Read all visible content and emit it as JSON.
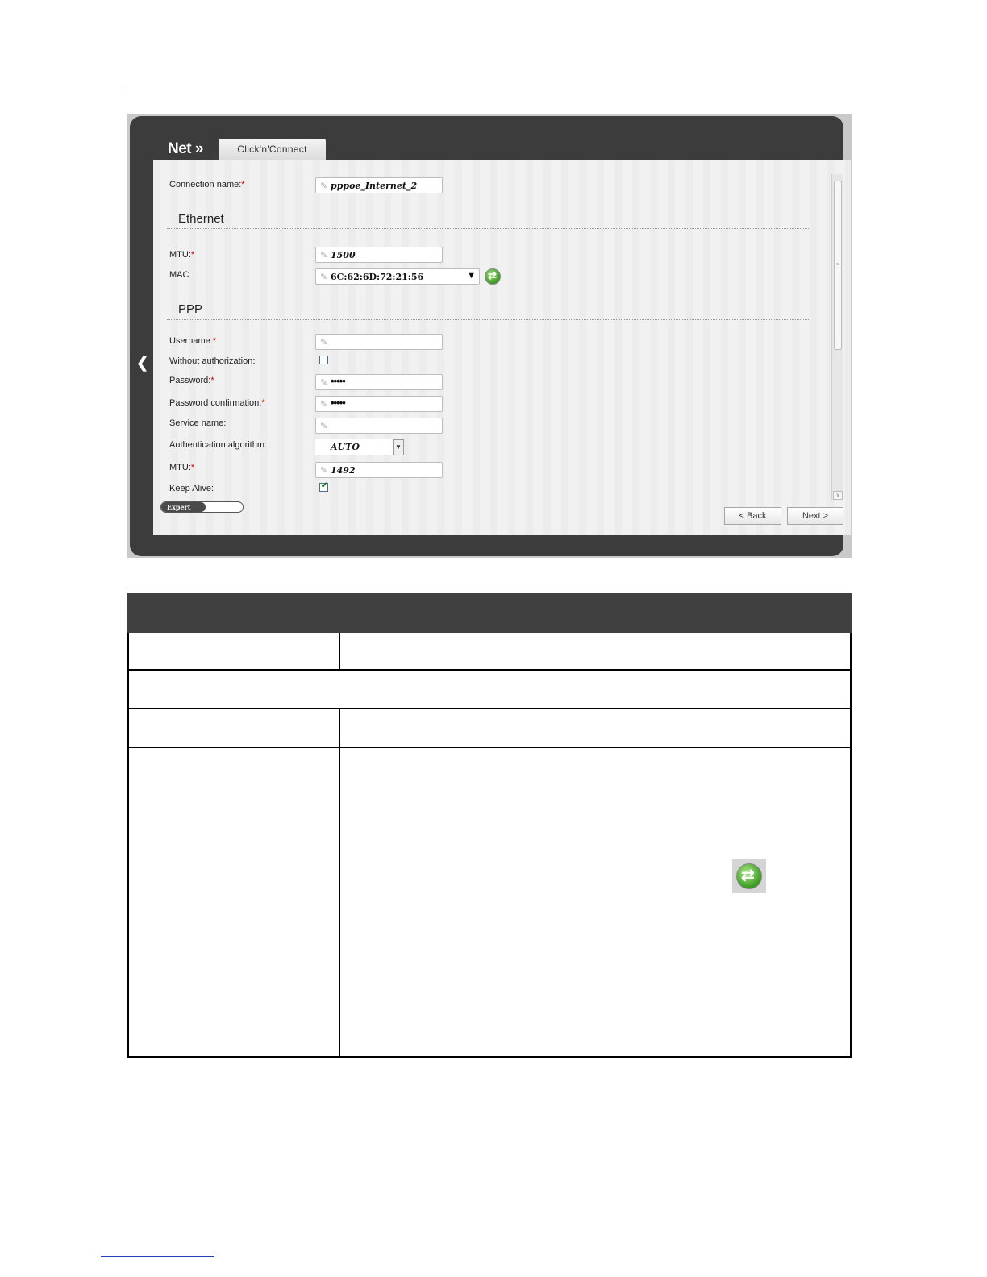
{
  "header": {
    "logo": "Net »",
    "tab": "Click'n'Connect"
  },
  "form": {
    "connection_name": {
      "label": "Connection name:",
      "value": "pppoe_Internet_2"
    },
    "ethernet": {
      "title": "Ethernet",
      "mtu": {
        "label": "MTU:",
        "value": "1500"
      },
      "mac": {
        "label": "MAC",
        "value": "6C:62:6D:72:21:56"
      }
    },
    "ppp": {
      "title": "PPP",
      "username": {
        "label": "Username:",
        "value": ""
      },
      "without_auth": {
        "label": "Without authorization:",
        "checked": false
      },
      "password": {
        "label": "Password:",
        "value": "•••••"
      },
      "password_confirm": {
        "label": "Password confirmation:",
        "value": "•••••"
      },
      "service_name": {
        "label": "Service name:",
        "value": ""
      },
      "auth_algorithm": {
        "label": "Authentication algorithm:",
        "value": "AUTO"
      },
      "mtu": {
        "label": "MTU:",
        "value": "1492"
      },
      "keep_alive": {
        "label": "Keep Alive:",
        "checked": true
      }
    },
    "required_mark": "*"
  },
  "footer": {
    "expert": "Expert",
    "back": "< Back",
    "next": "Next >"
  },
  "colors": {
    "frame": "#3c3c3c",
    "panel": "#f1f1f1",
    "required": "#cc0000",
    "table_header": "#404040"
  }
}
